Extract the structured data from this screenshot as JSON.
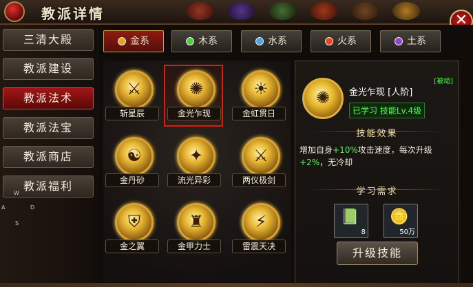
{
  "window": {
    "title": "教派详情",
    "close_label": "✕"
  },
  "sidebar": {
    "items": [
      {
        "label": "三清大殿",
        "active": false
      },
      {
        "label": "教派建设",
        "active": false
      },
      {
        "label": "教派法术",
        "active": true
      },
      {
        "label": "教派法宝",
        "active": false
      },
      {
        "label": "教派商店",
        "active": false
      },
      {
        "label": "教派福利",
        "active": false
      }
    ],
    "keys": [
      "W",
      "A",
      "D",
      "S"
    ]
  },
  "tabs": [
    {
      "label": "金系",
      "dot_color": "#e7a22a",
      "active": true
    },
    {
      "label": "木系",
      "dot_color": "#4ccf3c",
      "active": false
    },
    {
      "label": "水系",
      "dot_color": "#49a7e8",
      "active": false
    },
    {
      "label": "火系",
      "dot_color": "#e8481c",
      "active": false
    },
    {
      "label": "土系",
      "dot_color": "#9b3ed0",
      "active": false
    }
  ],
  "skills": [
    {
      "name": "斩星辰",
      "icon": "sword-burst-icon",
      "glyph": "⚔",
      "selected": false
    },
    {
      "name": "金光乍现",
      "icon": "golden-bomb-icon",
      "glyph": "✺",
      "selected": true
    },
    {
      "name": "金虹贯日",
      "icon": "golden-warrior-icon",
      "glyph": "☀",
      "selected": false
    },
    {
      "name": "金丹砂",
      "icon": "yin-yang-icon",
      "glyph": "☯",
      "selected": false
    },
    {
      "name": "流光异彩",
      "icon": "golden-sage-icon",
      "glyph": "✦",
      "selected": false
    },
    {
      "name": "两仪极剑",
      "icon": "sword-icon",
      "glyph": "⚔",
      "selected": false
    },
    {
      "name": "金之翼",
      "icon": "shield-icon",
      "glyph": "⛨",
      "selected": false
    },
    {
      "name": "金甲力士",
      "icon": "golden-armor-icon",
      "glyph": "♜",
      "selected": false
    },
    {
      "name": "雷震天决",
      "icon": "thunder-icon",
      "glyph": "⚡",
      "selected": false
    }
  ],
  "detail": {
    "passive_label": "[被动]",
    "name": "金光乍现 [人阶]",
    "level_text": "已学习 技能Lv.4级",
    "effect_title": "技能效果",
    "desc_prefix": "增加自身",
    "desc_value1": "+10%",
    "desc_mid": "攻击速度，每次升级",
    "desc_value2": "+2%",
    "desc_suffix": "，无冷却",
    "req_title": "学习需求",
    "items": [
      {
        "icon": "jade-book-icon",
        "glyph": "📗",
        "count": "8"
      },
      {
        "icon": "gold-ingot-icon",
        "glyph": "🪙",
        "count": "50万"
      }
    ],
    "upgrade_label": "升级技能"
  }
}
